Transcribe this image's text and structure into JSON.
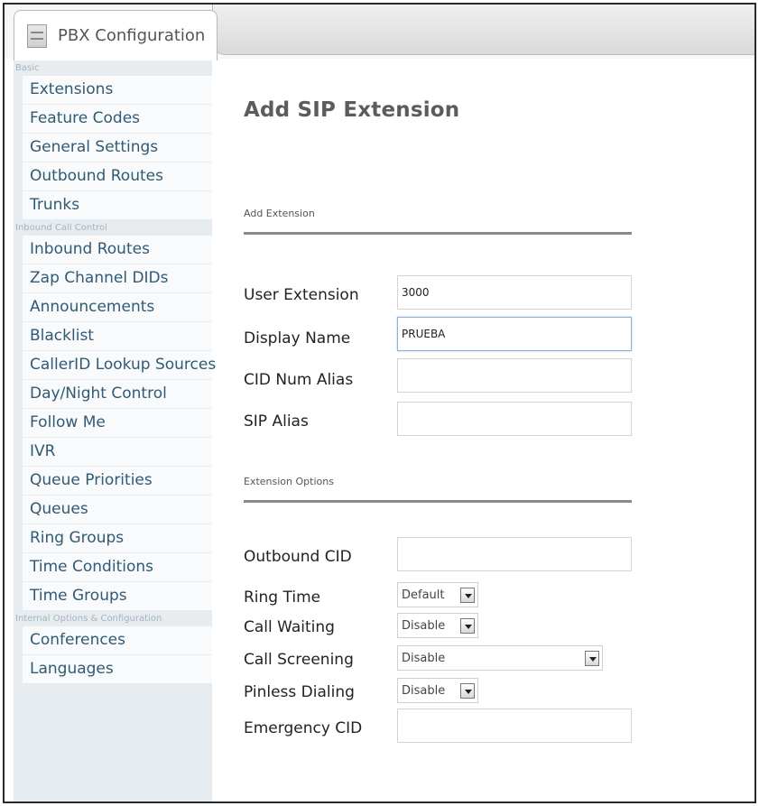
{
  "tab": {
    "label": "PBX Configuration",
    "icon": "document-icon"
  },
  "sidebar": {
    "sections": [
      {
        "title": "Basic",
        "items": [
          "Extensions",
          "Feature Codes",
          "General Settings",
          "Outbound Routes",
          "Trunks"
        ]
      },
      {
        "title": "Inbound Call Control",
        "items": [
          "Inbound Routes",
          "Zap Channel DIDs",
          "Announcements",
          "Blacklist",
          "CallerID Lookup Sources",
          "Day/Night Control",
          "Follow Me",
          "IVR",
          "Queue Priorities",
          "Queues",
          "Ring Groups",
          "Time Conditions",
          "Time Groups"
        ]
      },
      {
        "title": "Internal Options & Configuration",
        "items": [
          "Conferences",
          "Languages"
        ]
      }
    ]
  },
  "main": {
    "title": "Add SIP Extension",
    "add_extension": {
      "heading": "Add Extension",
      "user_extension": {
        "label": "User Extension",
        "value": "3000"
      },
      "display_name": {
        "label": "Display Name",
        "value": "PRUEBA"
      },
      "cid_num_alias": {
        "label": "CID Num Alias",
        "value": ""
      },
      "sip_alias": {
        "label": "SIP Alias",
        "value": ""
      }
    },
    "extension_options": {
      "heading": "Extension Options",
      "outbound_cid": {
        "label": "Outbound CID",
        "value": ""
      },
      "ring_time": {
        "label": "Ring Time",
        "value": "Default"
      },
      "call_waiting": {
        "label": "Call Waiting",
        "value": "Disable"
      },
      "call_screening": {
        "label": "Call Screening",
        "value": "Disable"
      },
      "pinless_dialing": {
        "label": "Pinless Dialing",
        "value": "Disable"
      },
      "emergency_cid": {
        "label": "Emergency CID",
        "value": ""
      }
    }
  }
}
